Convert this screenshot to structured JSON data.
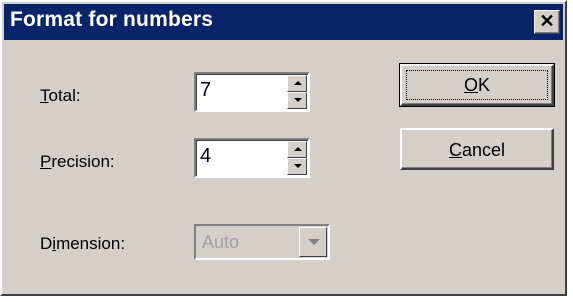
{
  "window": {
    "title": "Format for numbers",
    "close_glyph": "✕"
  },
  "fields": {
    "total": {
      "label_accel": "T",
      "label_rest": "otal:",
      "value": "7"
    },
    "precision": {
      "label_accel": "P",
      "label_rest": "recision:",
      "value": "4"
    },
    "dimension": {
      "label_pre": "D",
      "label_accel": "i",
      "label_rest": "mension:",
      "value": "Auto",
      "disabled": true
    }
  },
  "buttons": {
    "ok": {
      "accel": "O",
      "rest": "K"
    },
    "cancel": {
      "accel": "C",
      "rest": "ancel"
    }
  },
  "colors": {
    "titlebar": "#0a246a",
    "face": "#d4d0c8"
  }
}
